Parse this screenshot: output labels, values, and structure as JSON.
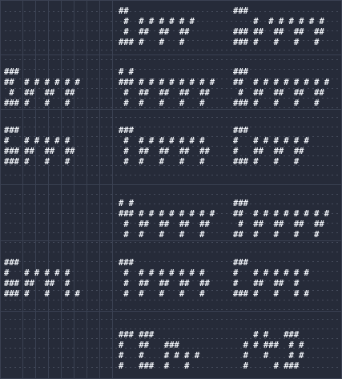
{
  "theme": {
    "background": "#262b39",
    "text": "#eef1f6",
    "grid_dot": "#626a7c",
    "grid_line": "#3a4152"
  },
  "blocks": [
    {
      "name": "block-1-center",
      "lines": [
        "##",
        " #  # # # # # #",
        " #  ##  ##  ##",
        "### #   #   #"
      ]
    },
    {
      "name": "block-1-right",
      "lines": [
        "###",
        "    #  # # # # # #",
        "### ##  ##  ##  ##",
        "### #   #   #   #"
      ]
    },
    {
      "name": "block-2-left",
      "lines": [
        "###",
        "##  # # # # # #",
        " #  ##  ##  ##",
        "### #   #   #"
      ]
    },
    {
      "name": "block-2-center",
      "lines": [
        "# #",
        "### # # # # # # # #",
        " #  ##  ##  ##  ##",
        " #  #   #   #   #"
      ]
    },
    {
      "name": "block-2-right",
      "lines": [
        "###",
        "##  # # # # # # # #",
        " #  ##  ##  ##  ##",
        "### #   #   #   #"
      ]
    },
    {
      "name": "block-3-left",
      "lines": [
        "###",
        "#   # # # # #",
        "### ##  ##  ##",
        "### #   #   #"
      ]
    },
    {
      "name": "block-3-center",
      "lines": [
        "###",
        " #  # # # # # # #",
        " #  ##  ##  ##  ##",
        " #  #   #   #   #"
      ]
    },
    {
      "name": "block-3-right",
      "lines": [
        "###",
        "#   # # # # # #",
        "#   ##  ##  ##",
        "### #   #   #"
      ]
    },
    {
      "name": "block-4-center",
      "lines": [
        "# #",
        "### # # # # # # # #",
        " #  ##  ##  ##  ##",
        " #  #   #   #   #"
      ]
    },
    {
      "name": "block-4-right",
      "lines": [
        "###",
        "##  # # # # # # # #",
        " #  ##  ##  ##  ##",
        "##  #   #   #   #"
      ]
    },
    {
      "name": "block-5-left",
      "lines": [
        "###",
        "#   # # # # #",
        "### ##  ##  #",
        "### #   #   # #"
      ]
    },
    {
      "name": "block-5-center",
      "lines": [
        "###",
        " #  # # # # # # #",
        " #  ##  ##  ##  ##",
        " #  #   #   #   #"
      ]
    },
    {
      "name": "block-5-right",
      "lines": [
        "###",
        "#   # # # # # #",
        "#   ##  ##  #",
        "### #   #   # #"
      ]
    },
    {
      "name": "block-6-center",
      "lines": [
        "### ###",
        "#   ##   ###",
        "#   #    # # # #",
        "#   ###  #   #"
      ]
    },
    {
      "name": "block-6-right",
      "lines": [
        "    # #   ###",
        "  # # ###  # #",
        "  #   #    # #",
        "  #     # ###"
      ]
    }
  ]
}
